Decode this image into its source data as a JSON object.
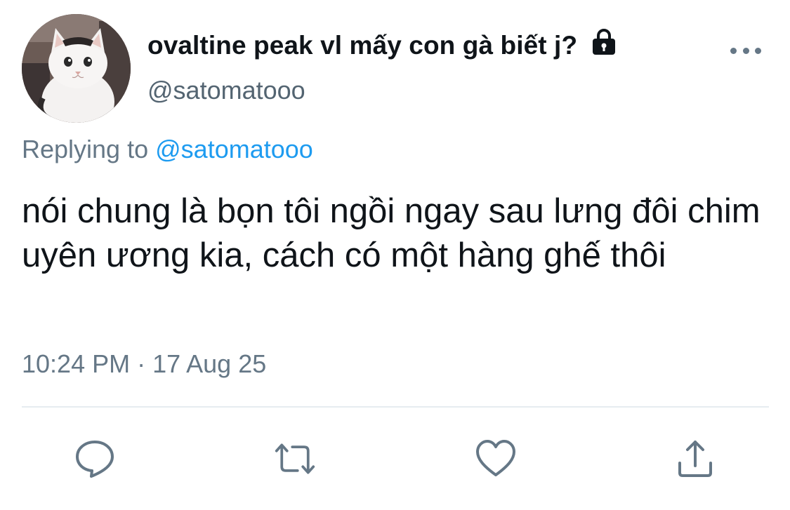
{
  "tweet": {
    "display_name": "ovaltine peak vl mấy con gà biết j?",
    "handle": "@satomatooo",
    "reply_prefix": "Replying to",
    "reply_to": "@satomatooo",
    "text": "nói chung là bọn tôi ngồi ngay sau lưng đôi chim uyên ương kia, cách có một hàng ghế thôi",
    "timestamp": "10:24 PM · 17 Aug 25",
    "protected_icon": "lock-icon",
    "more_icon": "more-horizontal-icon"
  },
  "actions": [
    {
      "name": "reply",
      "icon": "comment-icon"
    },
    {
      "name": "retweet",
      "icon": "retweet-icon"
    },
    {
      "name": "like",
      "icon": "heart-icon"
    },
    {
      "name": "share",
      "icon": "share-icon"
    }
  ],
  "colors": {
    "text": "#0f1419",
    "secondary": "#657786",
    "link": "#1d9bf0",
    "divider": "#e6ecf0"
  }
}
